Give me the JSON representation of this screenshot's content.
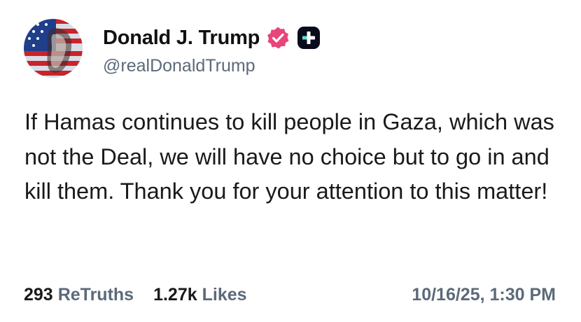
{
  "post": {
    "author_name": "Donald J. Trump",
    "author_handle": "@realDonaldTrump",
    "text": "If Hamas continues to kill people in Gaza, which was not the Deal, we will have no choice but to go in and kill them. Thank you for your attention to this matter!",
    "retruths_count": "293",
    "retruths_label": "ReTruths",
    "likes_count": "1.27k",
    "likes_label": "Likes",
    "timestamp": "10/16/25, 1:30 PM"
  },
  "icons": {
    "verified": "verified-badge-icon",
    "plus": "plus-badge-icon",
    "avatar": "avatar-image"
  },
  "colors": {
    "verified_badge": "#e8457a",
    "plus_badge": "#0b0b1e",
    "plus_accent": "#5fe0d6",
    "muted_text": "#5c6a7a"
  }
}
